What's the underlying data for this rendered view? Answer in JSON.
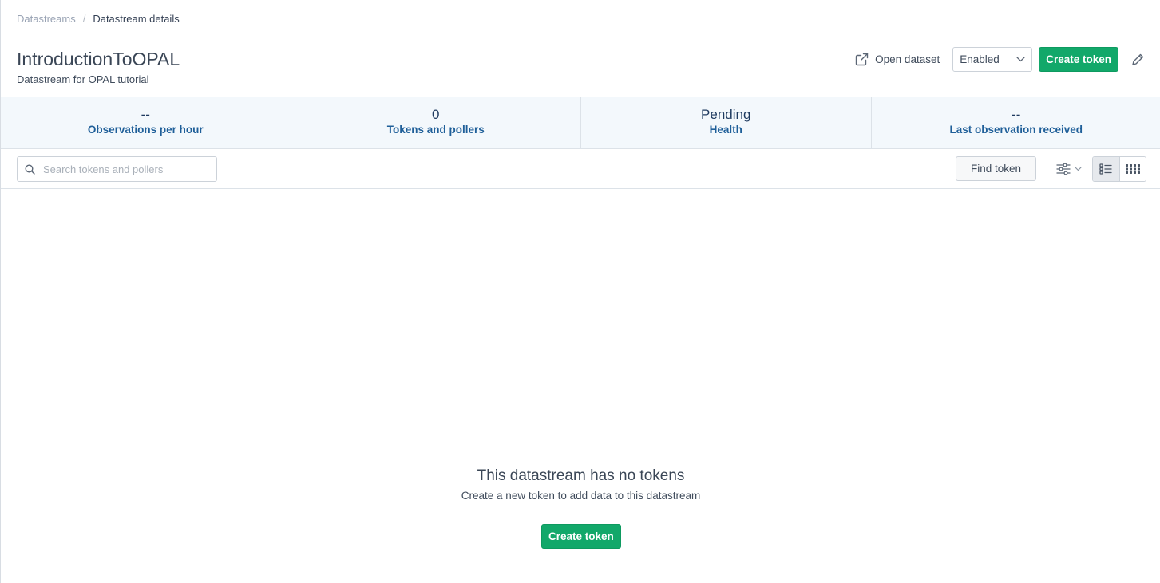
{
  "breadcrumb": {
    "parent": "Datastreams",
    "separator": "/",
    "current": "Datastream details"
  },
  "header": {
    "title": "IntroductionToOPAL",
    "subtitle": "Datastream for OPAL tutorial",
    "open_dataset_label": "Open dataset",
    "status_select": {
      "value": "Enabled"
    },
    "create_token_label": "Create token"
  },
  "stats": [
    {
      "value": "--",
      "label": "Observations per hour"
    },
    {
      "value": "0",
      "label": "Tokens and pollers"
    },
    {
      "value": "Pending",
      "label": "Health"
    },
    {
      "value": "--",
      "label": "Last observation received"
    }
  ],
  "toolbar": {
    "search_placeholder": "Search tokens and pollers",
    "find_token_label": "Find token"
  },
  "empty_state": {
    "title": "This datastream has no tokens",
    "description": "Create a new token to add data to this datastream",
    "button_label": "Create token"
  },
  "colors": {
    "primary": "#12a86a",
    "stat_label": "#1f5f99",
    "stats_bg": "#f3f8fc"
  },
  "icons": {
    "open_dataset": "external-link-icon",
    "select": "chevron-down-icon",
    "edit": "pencil-icon",
    "search": "search-icon",
    "filter": "sliders-icon",
    "list_view": "list-view-icon",
    "grid_view": "grid-view-icon"
  }
}
